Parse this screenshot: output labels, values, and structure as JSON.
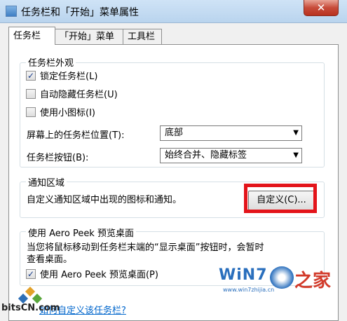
{
  "window": {
    "title": "任务栏和「开始」菜单属性",
    "close_label": "✕"
  },
  "tabs": [
    {
      "label": "任务栏"
    },
    {
      "label": "「开始」菜单"
    },
    {
      "label": "工具栏"
    }
  ],
  "appearance": {
    "title": "任务栏外观",
    "lock": {
      "label": "锁定任务栏(L)",
      "checked": true
    },
    "autohide": {
      "label": "自动隐藏任务栏(U)",
      "checked": false
    },
    "small_icons": {
      "label": "使用小图标(I)",
      "checked": false
    },
    "position_label": "屏幕上的任务栏位置(T):",
    "position_value": "底部",
    "buttons_label": "任务栏按钮(B):",
    "buttons_value": "始终合并、隐藏标签"
  },
  "notify": {
    "title": "通知区域",
    "desc": "自定义通知区域中出现的图标和通知。",
    "customize_label": "自定义(C)..."
  },
  "peek": {
    "title": "使用 Aero Peek 预览桌面",
    "desc_line1": "当您将鼠标移动到任务栏末端的“显示桌面”按钮时，会暂时",
    "desc_line2": "查看桌面。",
    "checkbox": {
      "label": "使用 Aero Peek 预览桌面(P)",
      "checked": true
    }
  },
  "link": {
    "label": "如何自定义该任务栏?"
  },
  "watermarks": {
    "win7": "WiN7",
    "url": "www.win7zhijia.cn",
    "jia": "之家",
    "bits": "bitsCN.com"
  },
  "colors": {
    "highlight": "#e3141a",
    "link": "#0066cc"
  }
}
